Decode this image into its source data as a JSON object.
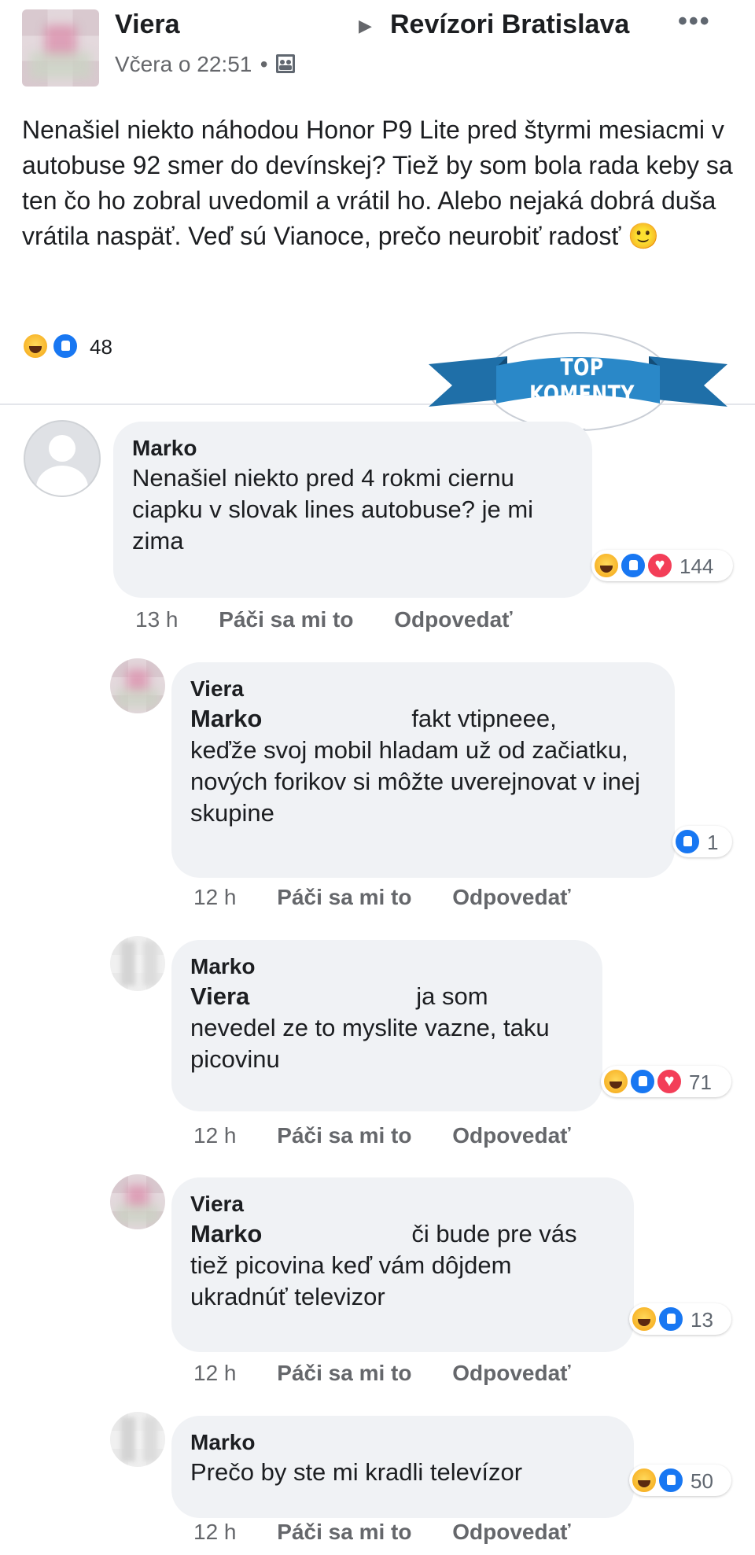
{
  "post": {
    "author": "Viera",
    "time": "Včera o 22:51",
    "separator": "•",
    "privacy_icon": "group-privacy-icon",
    "arrow": "▶",
    "group": "Revízori Bratislava",
    "more": "•••",
    "body": "Nenašiel niekto náhodou Honor P9 Lite pred štyrmi mesiacmi v autobuse 92 smer do devínskej? Tiež by som bola rada keby sa ten čo ho zobral uvedomil a vrátil ho. Alebo nejaká dobrá duša vrátila naspäť. Veď sú Vianoce, prečo neurobiť radosť 🙂",
    "reactions": [
      "haha",
      "like"
    ],
    "reaction_count": "48"
  },
  "badge": {
    "label": "TOP KOMENTY"
  },
  "comments": [
    {
      "author": "Marko",
      "text": "Nenašiel niekto pred 4 rokmi ciernu ciapku v slovak lines autobuse? je mi zima",
      "reactions": [
        "haha",
        "like",
        "love"
      ],
      "reaction_count": "144",
      "time": "13 h",
      "like": "Páči sa mi to",
      "reply": "Odpovedať"
    },
    {
      "author": "Viera",
      "mention": "Marko",
      "text_after_mention": "fakt vtipneee,",
      "text_rest": "keďže svoj mobil hladam už od začiatku, nových forikov si môžte uverejnovat v inej skupine",
      "reactions": [
        "like"
      ],
      "reaction_count": "1",
      "time": "12 h",
      "like": "Páči sa mi to",
      "reply": "Odpovedať"
    },
    {
      "author": "Marko",
      "mention": "Viera",
      "text_after_mention": "ja som",
      "text_rest": "nevedel ze to myslite vazne, taku picovinu",
      "reactions": [
        "haha",
        "like",
        "love"
      ],
      "reaction_count": "71",
      "time": "12 h",
      "like": "Páči sa mi to",
      "reply": "Odpovedať"
    },
    {
      "author": "Viera",
      "mention": "Marko",
      "text_after_mention": "či bude pre vás",
      "text_rest": "tiež picovina keď vám dôjdem ukradnúť televizor",
      "reactions": [
        "haha",
        "like"
      ],
      "reaction_count": "13",
      "time": "12 h",
      "like": "Páči sa mi to",
      "reply": "Odpovedať"
    },
    {
      "author": "Marko",
      "text": "Prečo by ste mi kradli televízor",
      "reactions": [
        "haha",
        "like"
      ],
      "reaction_count": "50",
      "time": "12 h",
      "like": "Páči sa mi to",
      "reply": "Odpovedať"
    }
  ]
}
